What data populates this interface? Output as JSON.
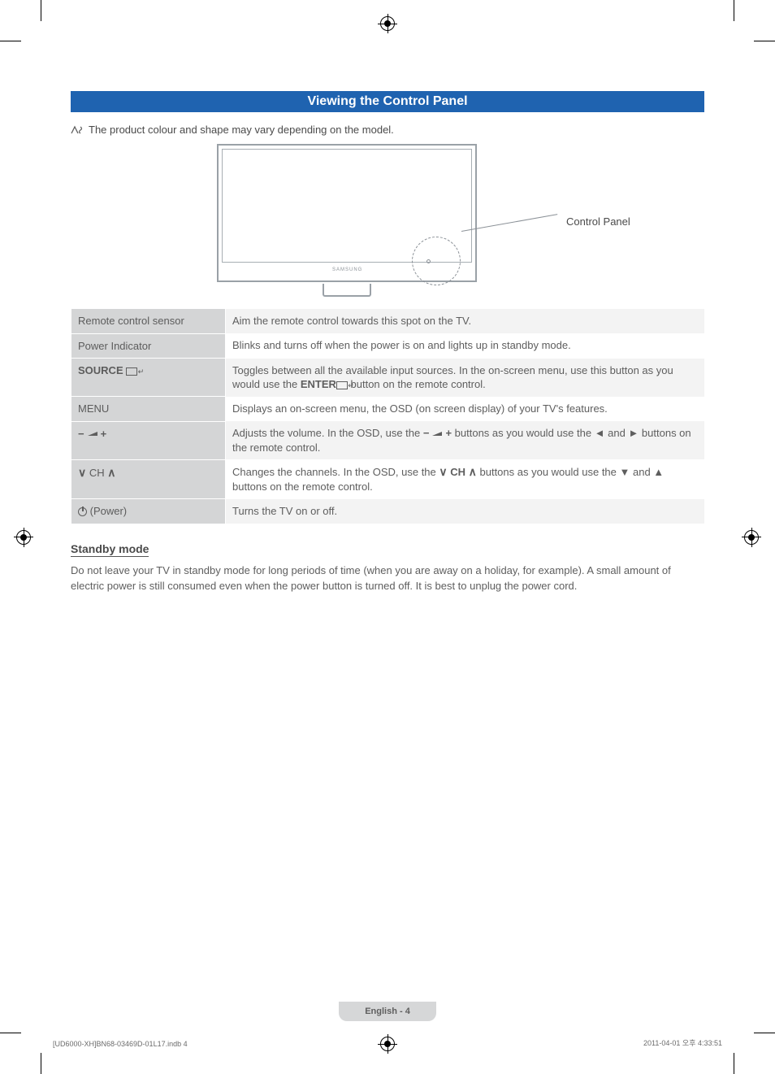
{
  "title": "Viewing the Control Panel",
  "note": {
    "text": "The product colour and shape may vary depending on the model."
  },
  "illustration": {
    "brand": "SAMSUNG",
    "lead_label": "Control Panel"
  },
  "rows": [
    {
      "label": "Remote control sensor",
      "label_style": "plain",
      "desc": "Aim the remote control towards this spot on the TV."
    },
    {
      "label": "Power Indicator",
      "label_style": "plain",
      "desc": "Blinks and turns off when the power is on and lights up in standby mode."
    },
    {
      "label": "SOURCE",
      "label_style": "source",
      "desc_prefix": "Toggles between all the available input sources. In the on-screen menu, use this button as you would use the ",
      "desc_mid_bold": "ENTER",
      "desc_suffix": " button on the remote control."
    },
    {
      "label": "MENU",
      "label_style": "bold",
      "desc": "Displays an on-screen menu, the OSD (on screen display) of your TV's features."
    },
    {
      "label": "vol",
      "label_style": "volume",
      "desc_prefix": "Adjusts the volume. In the OSD, use the ",
      "desc_suffix": " buttons as you would use the ◄ and ► buttons on the remote control."
    },
    {
      "label": "CH",
      "label_style": "channel",
      "desc_prefix": "Changes the channels. In the OSD, use the ",
      "desc_suffix": " buttons as you would use the ▼ and ▲ buttons on the remote control."
    },
    {
      "label": "(Power)",
      "label_style": "power",
      "desc": "Turns the TV on or off."
    }
  ],
  "standby": {
    "heading": "Standby mode",
    "body": "Do not leave your TV in standby mode for long periods of time (when you are away on a holiday, for example). A small amount of electric power is still consumed even when the power button is turned off. It is best to unplug the power cord."
  },
  "footer": {
    "page_label": "English - 4",
    "print_left": "[UD6000-XH]BN68-03469D-01L17.indb   4",
    "print_right": "2011-04-01   오후 4:33:51"
  }
}
